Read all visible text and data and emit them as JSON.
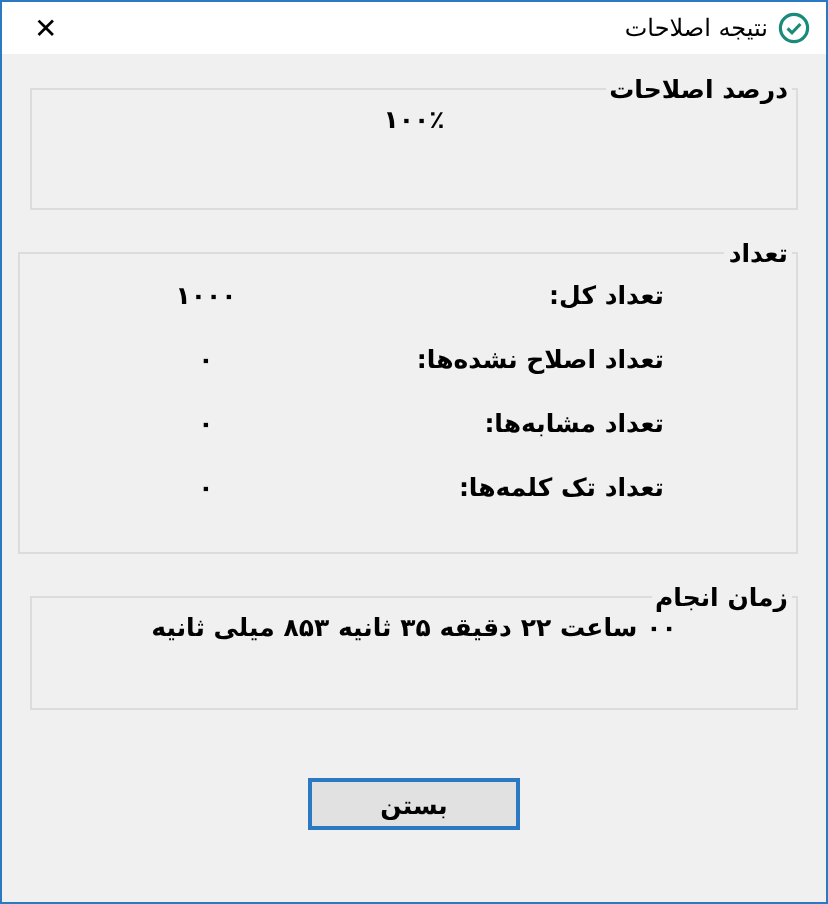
{
  "window": {
    "title": "نتیجه اصلاحات",
    "close": "✕"
  },
  "groups": [
    {
      "kind": "single",
      "title": "درصد اصلاحات",
      "value": "۱۰۰٪"
    },
    {
      "kind": "rows",
      "title": "تعداد",
      "rows": [
        {
          "label": "تعداد کل:",
          "value": "۱۰۰۰"
        },
        {
          "label": "تعداد اصلاح نشده‌ها:",
          "value": "۰"
        },
        {
          "label": "تعداد مشابه‌ها:",
          "value": "۰"
        },
        {
          "label": "تعداد تک کلمه‌ها:",
          "value": "۰"
        }
      ]
    },
    {
      "kind": "single",
      "title": "زمان انجام",
      "value": "۰۰ ساعت ۲۲ دقیقه ۳۵ ثانیه ۸۵۳ میلی ثانیه"
    }
  ],
  "buttons": [
    {
      "label": "بستن",
      "focused": true
    }
  ]
}
